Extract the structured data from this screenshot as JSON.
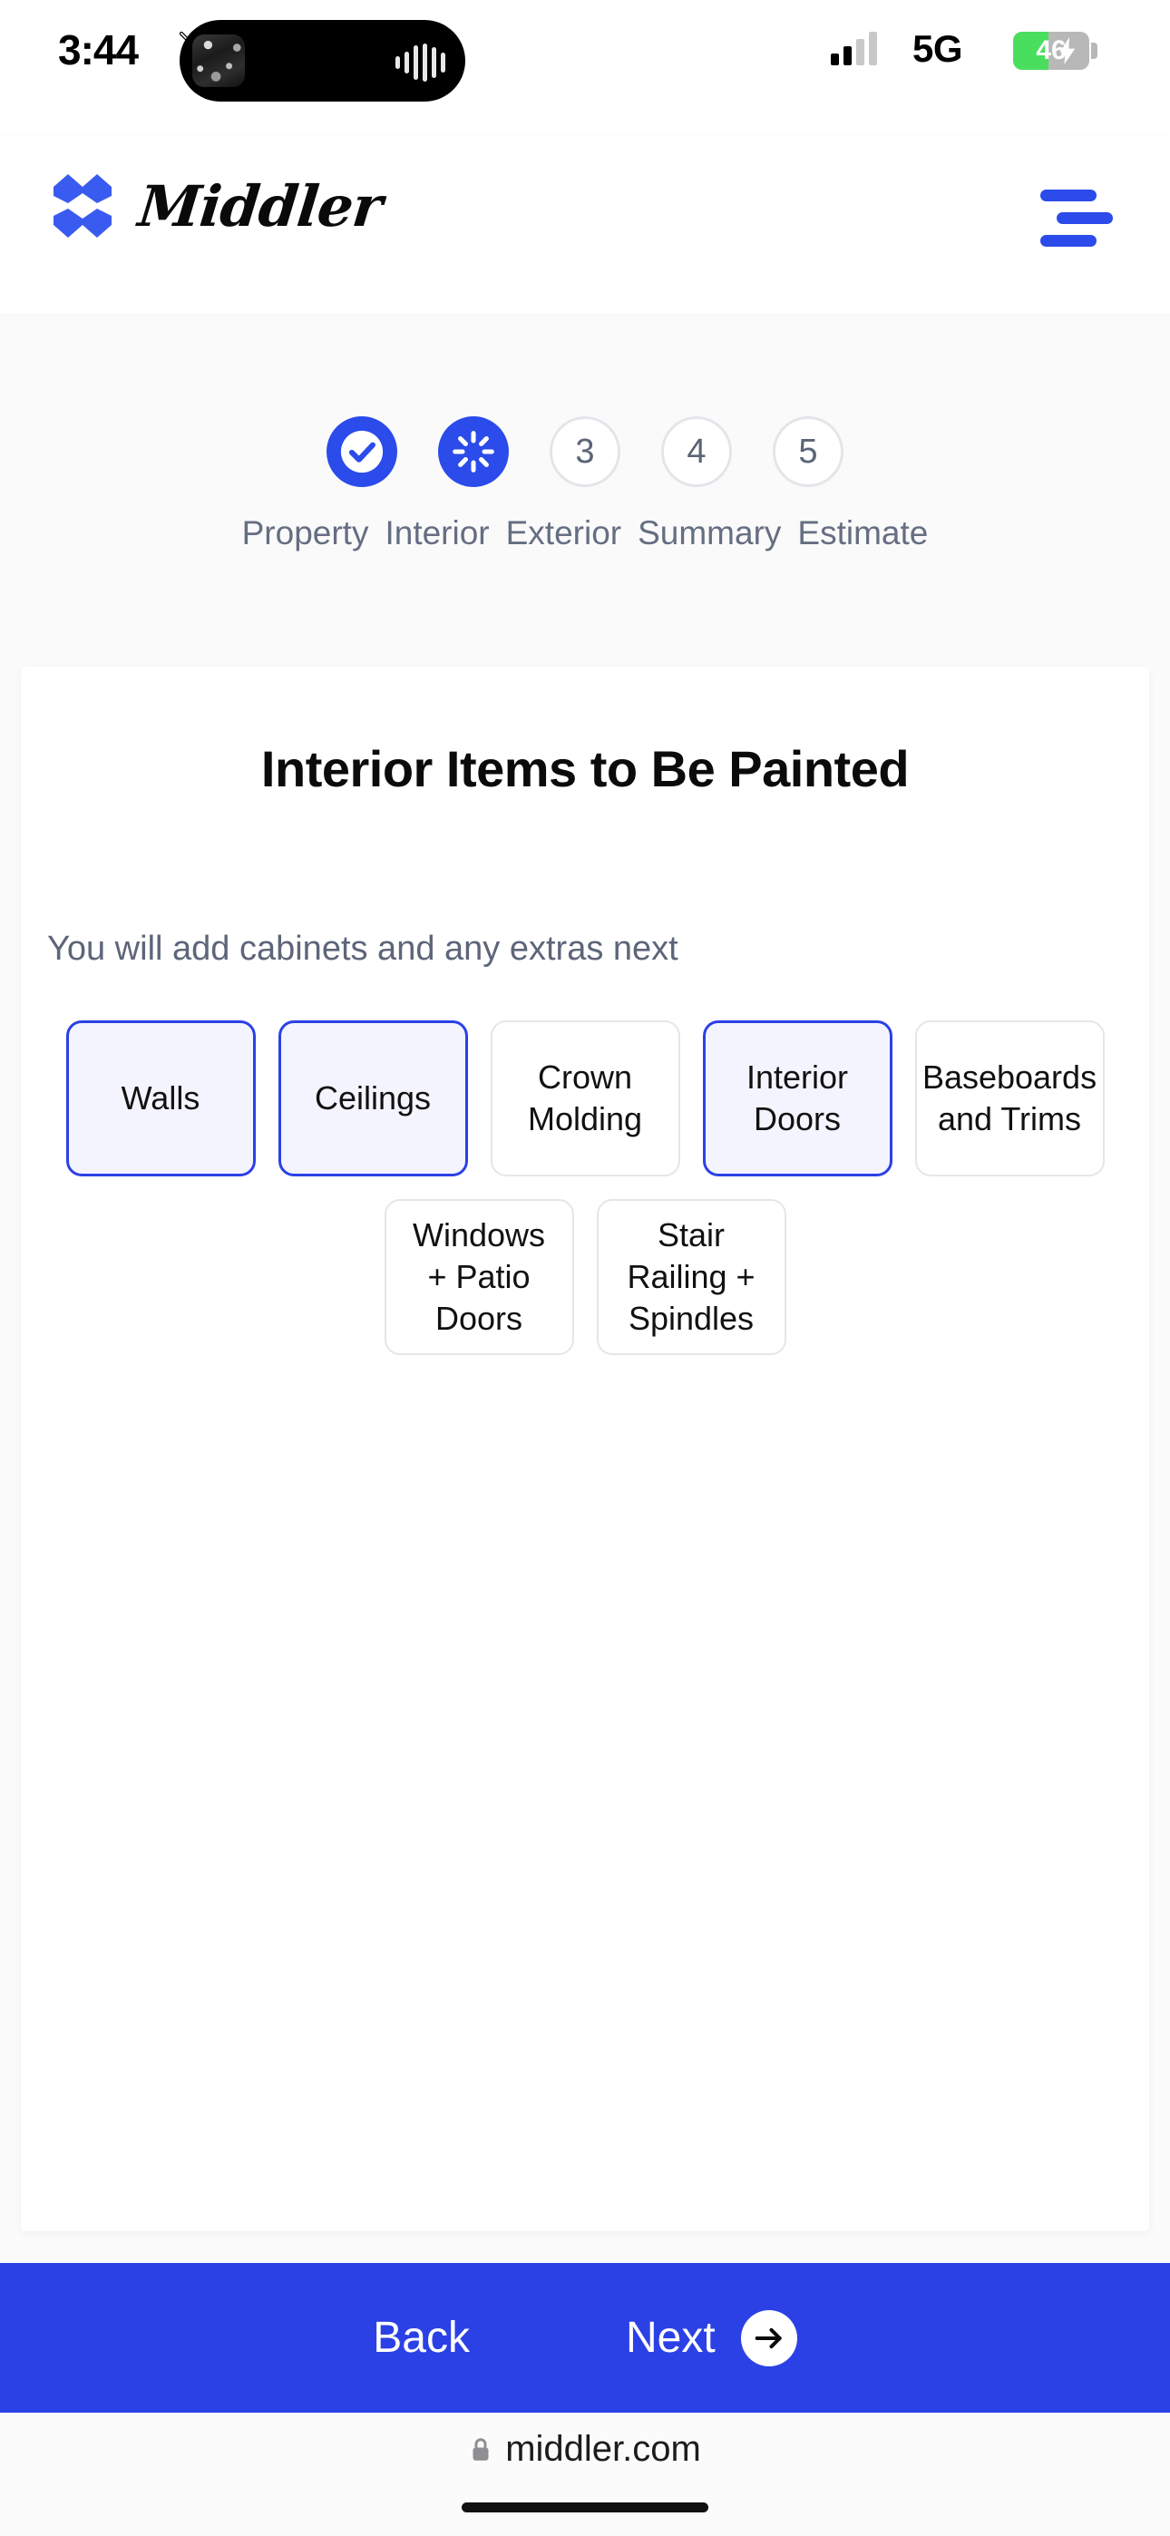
{
  "status_bar": {
    "time": "3:44",
    "mute_icon": "bell-slash-icon",
    "network_type": "5G",
    "battery_percent": "46",
    "battery_charging": true,
    "signal_bars_filled": 2,
    "signal_bars_total": 4
  },
  "header": {
    "brand_name": "Middler",
    "logo_icon": "middler-chevrons-logo",
    "menu_icon": "hamburger-menu-icon",
    "brand_color": "#2b4bea"
  },
  "stepper": {
    "steps": [
      {
        "number": "1",
        "label": "Property",
        "state": "done",
        "icon": "check-icon"
      },
      {
        "number": "2",
        "label": "Interior",
        "state": "current",
        "icon": "spinner-icon"
      },
      {
        "number": "3",
        "label": "Exterior",
        "state": "upcoming",
        "icon": ""
      },
      {
        "number": "4",
        "label": "Summary",
        "state": "upcoming",
        "icon": ""
      },
      {
        "number": "5",
        "label": "Estimate",
        "state": "upcoming",
        "icon": ""
      }
    ]
  },
  "main": {
    "title": "Interior Items to Be Painted",
    "subtitle": "You will add cabinets and any extras next",
    "options": [
      {
        "label": "Walls",
        "selected": true
      },
      {
        "label": "Ceilings",
        "selected": true
      },
      {
        "label": "Crown Molding",
        "selected": false
      },
      {
        "label": "Interior Doors",
        "selected": true
      },
      {
        "label": "Baseboards and Trims",
        "selected": false
      },
      {
        "label": "Windows + Patio Doors",
        "selected": false
      },
      {
        "label": "Stair Railing + Spindles",
        "selected": false
      }
    ],
    "selected_fill": "#f4f4fe",
    "selected_border": "#2b41e6"
  },
  "action_bar": {
    "back_label": "Back",
    "next_label": "Next",
    "next_icon": "arrow-right-icon",
    "background": "#2b41e6"
  },
  "browser_bar": {
    "lock_icon": "lock-icon",
    "url": "middler.com"
  }
}
